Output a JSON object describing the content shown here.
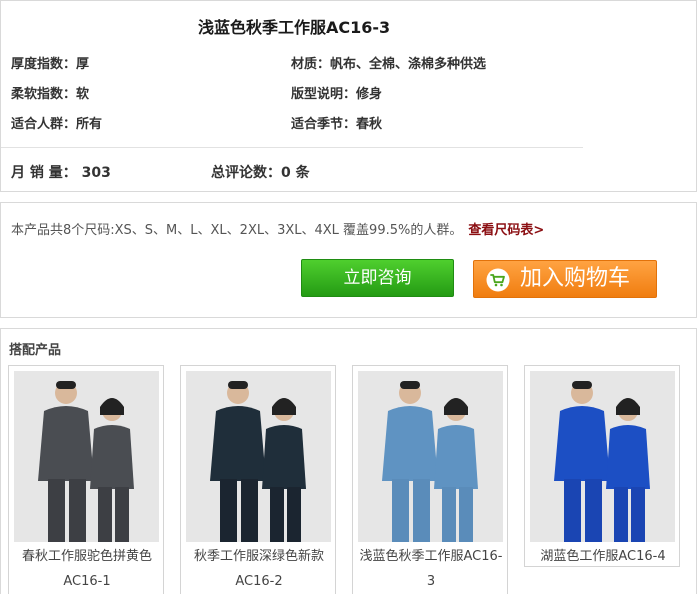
{
  "product": {
    "title": "浅蓝色秋季工作服AC16-3"
  },
  "attributes": [
    {
      "key": "厚度指数：",
      "value": "厚"
    },
    {
      "key": "材质：",
      "value": "帆布、全棉、涤棉多种供选"
    },
    {
      "key": "柔软指数：",
      "value": "软"
    },
    {
      "key": "版型说明：",
      "value": "修身"
    },
    {
      "key": "适合人群：",
      "value": "所有"
    },
    {
      "key": "适合季节：",
      "value": "春秋"
    }
  ],
  "stats": {
    "monthly_sales_label": "月 销 量：",
    "monthly_sales_value": "303",
    "reviews_label": "总评论数：",
    "reviews_value": "0",
    "reviews_unit": "条"
  },
  "sizes": {
    "text": "本产品共8个尺码:XS、S、M、L、XL、2XL、3XL、4XL 覆盖99.5%的人群。",
    "link": "查看尺码表>"
  },
  "buttons": {
    "consult": "立即咨询",
    "cart": "加入购物车",
    "cart_icon": "shopping-cart-icon"
  },
  "matching": {
    "title": "搭配产品",
    "items": [
      {
        "line1": "春秋工作服驼色拼黄色",
        "line2": "AC16-1",
        "jacket": "#4a4d52",
        "pants": "#3d3f44"
      },
      {
        "line1": "秋季工作服深绿色新款",
        "line2": "AC16-2",
        "jacket": "#1f2e3a",
        "pants": "#1b2530"
      },
      {
        "line1": "浅蓝色秋季工作服AC16-",
        "line2": "3",
        "jacket": "#5f93c2",
        "pants": "#5a8cba"
      },
      {
        "line1": "湖蓝色工作服AC16-4",
        "line2": "",
        "jacket": "#1c4fc4",
        "pants": "#1a45b3"
      }
    ]
  },
  "colors": {
    "consult_green": "#2fae1c",
    "cart_orange": "#f58a1f",
    "link_red": "#8b0e12"
  }
}
